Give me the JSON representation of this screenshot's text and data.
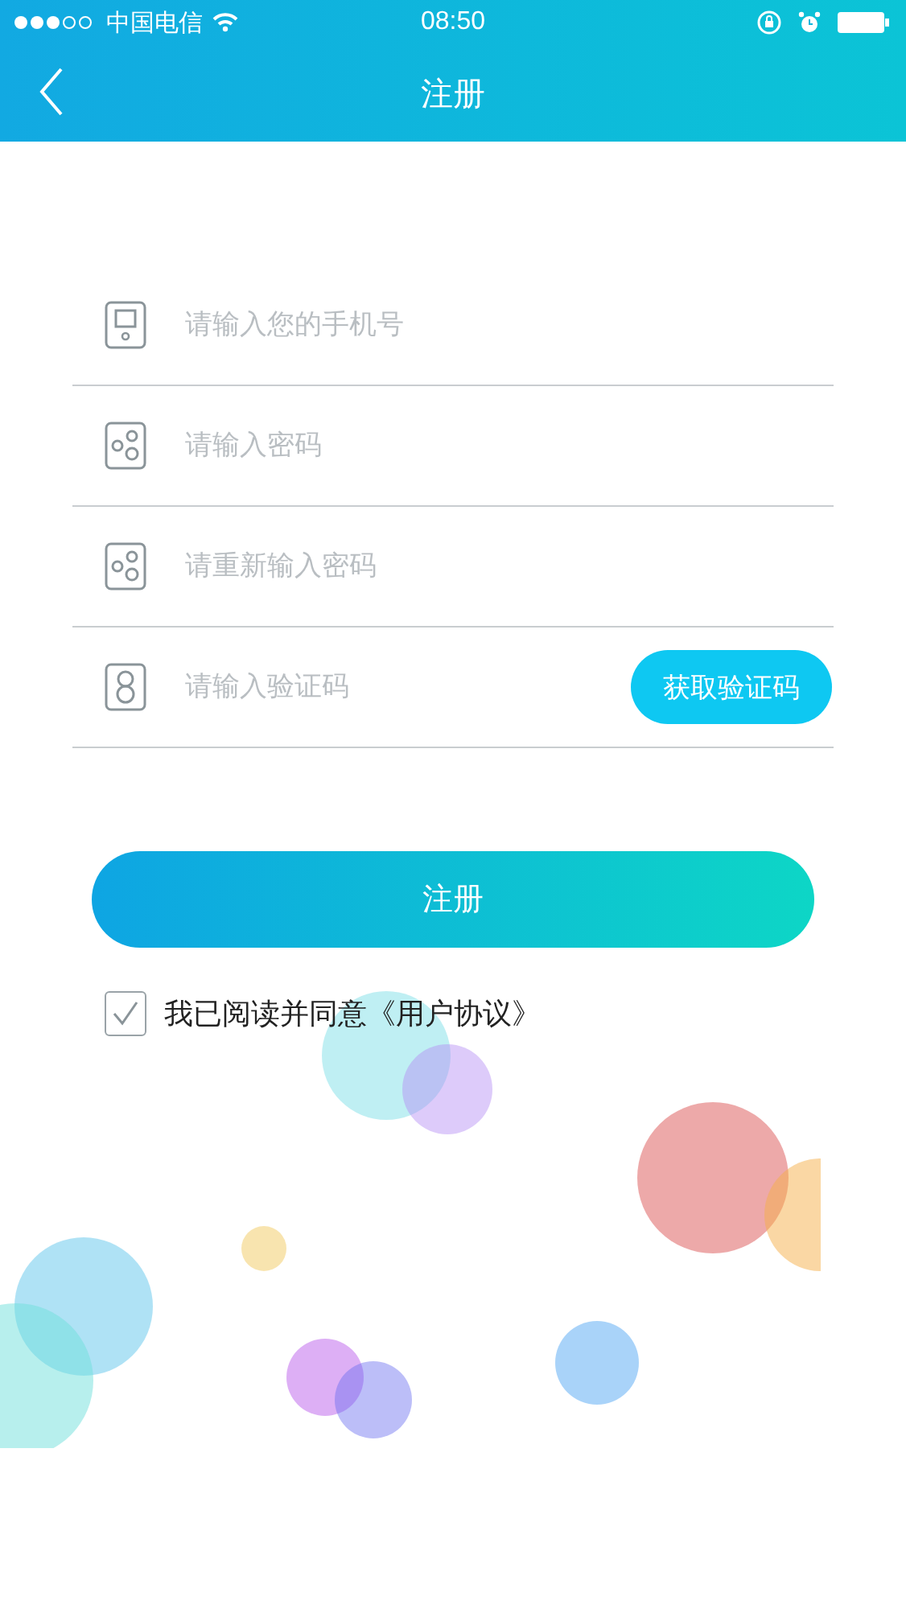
{
  "status_bar": {
    "carrier": "中国电信",
    "time": "08:50"
  },
  "nav": {
    "title": "注册"
  },
  "fields": [
    {
      "kind": "phone",
      "placeholder": "请输入您的手机号"
    },
    {
      "kind": "password",
      "placeholder": "请输入密码"
    },
    {
      "kind": "password",
      "placeholder": "请重新输入密码"
    },
    {
      "kind": "code",
      "placeholder": "请输入验证码",
      "button": "获取验证码"
    }
  ],
  "submit": {
    "label": "注册"
  },
  "agreement": {
    "checked": true,
    "text": "我已阅读并同意《用户协议》"
  }
}
